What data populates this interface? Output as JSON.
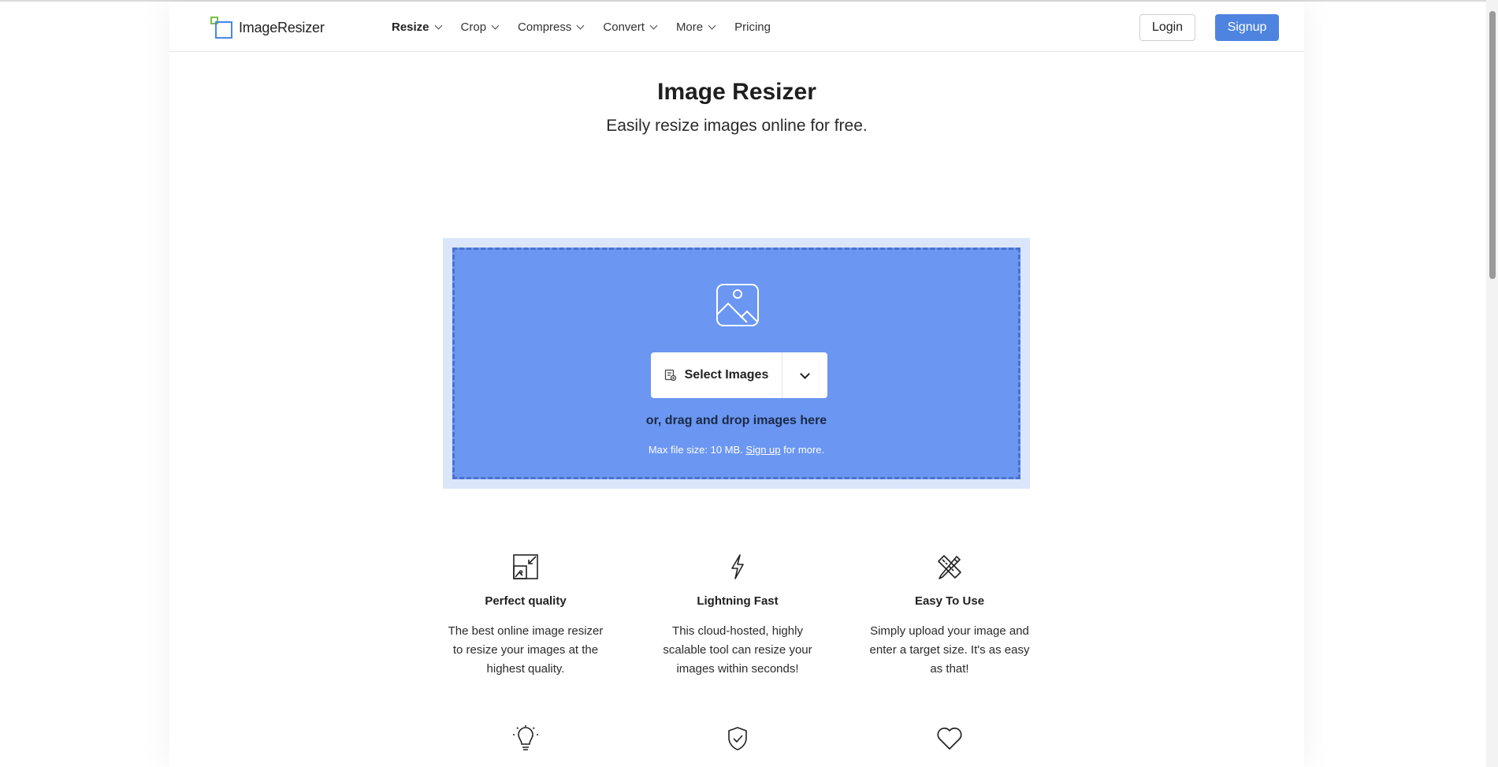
{
  "header": {
    "logo_text": "ImageResizer",
    "nav": [
      {
        "label": "Resize",
        "has_dropdown": true,
        "active": true
      },
      {
        "label": "Crop",
        "has_dropdown": true
      },
      {
        "label": "Compress",
        "has_dropdown": true
      },
      {
        "label": "Convert",
        "has_dropdown": true
      },
      {
        "label": "More",
        "has_dropdown": true
      },
      {
        "label": "Pricing",
        "has_dropdown": false
      }
    ],
    "login_label": "Login",
    "signup_label": "Signup"
  },
  "hero": {
    "title": "Image Resizer",
    "subtitle": "Easily resize images online for free."
  },
  "upload": {
    "select_label": "Select Images",
    "drag_text": "or, drag and drop images here",
    "max_prefix": "Max file size: 10 MB.",
    "signup_link": "Sign up",
    "max_suffix": "for more."
  },
  "features": [
    {
      "icon": "resize-icon",
      "name": "Perfect quality",
      "desc": "The best online image resizer to resize your images at the highest quality."
    },
    {
      "icon": "lightning-icon",
      "name": "Lightning Fast",
      "desc": "This cloud-hosted, highly scalable tool can resize your images within seconds!"
    },
    {
      "icon": "pencil-ruler-icon",
      "name": "Easy To Use",
      "desc": "Simply upload your image and enter a target size. It's as easy as that!"
    }
  ],
  "colors": {
    "accent": "#4e84e0",
    "dropzone": "#6b96f2",
    "dropzone_outer": "#dbe6fb",
    "logo_green": "#7ac143",
    "logo_blue": "#4a86e8"
  }
}
